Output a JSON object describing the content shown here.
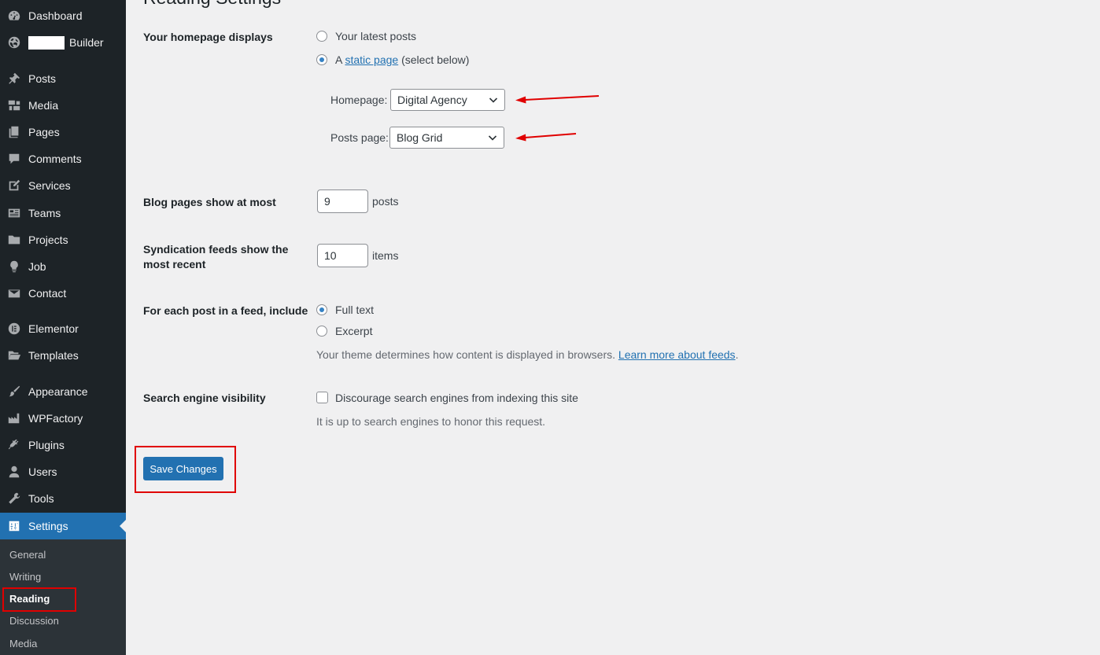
{
  "sidebar": {
    "items": [
      {
        "label": "Dashboard",
        "icon": "dashboard-icon"
      },
      {
        "label": "Builder",
        "icon": "globe-icon"
      },
      {
        "label": "Posts",
        "icon": "pin-icon"
      },
      {
        "label": "Media",
        "icon": "media-icon"
      },
      {
        "label": "Pages",
        "icon": "pages-icon"
      },
      {
        "label": "Comments",
        "icon": "comments-icon"
      },
      {
        "label": "Services",
        "icon": "edit-icon"
      },
      {
        "label": "Teams",
        "icon": "id-card-icon"
      },
      {
        "label": "Projects",
        "icon": "folder-icon"
      },
      {
        "label": "Job",
        "icon": "lightbulb-icon"
      },
      {
        "label": "Contact",
        "icon": "envelope-icon"
      },
      {
        "label": "Elementor",
        "icon": "elementor-icon"
      },
      {
        "label": "Templates",
        "icon": "folder-open-icon"
      },
      {
        "label": "Appearance",
        "icon": "paintbrush-icon"
      },
      {
        "label": "WPFactory",
        "icon": "factory-icon"
      },
      {
        "label": "Plugins",
        "icon": "plug-icon"
      },
      {
        "label": "Users",
        "icon": "user-icon"
      },
      {
        "label": "Tools",
        "icon": "wrench-icon"
      },
      {
        "label": "Settings",
        "icon": "settings-icon"
      }
    ],
    "submenu": [
      "General",
      "Writing",
      "Reading",
      "Discussion",
      "Media"
    ]
  },
  "main": {
    "page_title": "Reading Settings",
    "homepage_displays": {
      "label": "Your homepage displays",
      "option_latest": "Your latest posts",
      "option_static_prefix": "A ",
      "option_static_link": "static page",
      "option_static_suffix": " (select below)",
      "homepage_label": "Homepage:",
      "homepage_value": "Digital Agency",
      "posts_page_label": "Posts page:",
      "posts_page_value": "Blog Grid"
    },
    "blog_pages": {
      "label": "Blog pages show at most",
      "value": "9",
      "unit": "posts"
    },
    "syndication": {
      "label_line1": "Syndication feeds show the",
      "label_line2": "most recent",
      "value": "10",
      "unit": "items"
    },
    "feed_include": {
      "label": "For each post in a feed, include",
      "option_full": "Full text",
      "option_excerpt": "Excerpt",
      "desc_prefix": "Your theme determines how content is displayed in browsers. ",
      "desc_link": "Learn more about feeds",
      "desc_suffix": "."
    },
    "search_visibility": {
      "label": "Search engine visibility",
      "checkbox_label": "Discourage search engines from indexing this site",
      "desc": "It is up to search engines to honor this request."
    },
    "save_button": "Save Changes"
  },
  "colors": {
    "accent": "#2271b1",
    "sidebar": "#1d2327",
    "annotation": "#e00000"
  }
}
